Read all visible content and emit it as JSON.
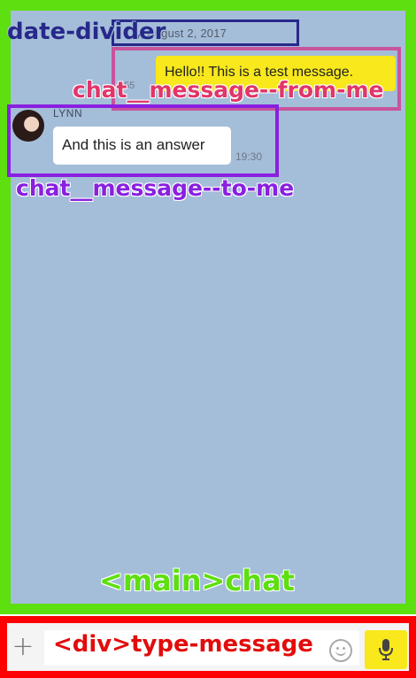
{
  "chat": {
    "date_divider": "…y, August 2, 2017",
    "messages": [
      {
        "direction": "from-me",
        "text": "Hello!! This is a test message.",
        "time": "55"
      },
      {
        "direction": "to-me",
        "sender": "LYNN",
        "text": "And this is an answer",
        "time": "19:30"
      }
    ]
  },
  "annotations": {
    "date_divider": "date-divider",
    "from_me": "chat__message--from-me",
    "to_me": "chat__message--to-me",
    "main": "<main>chat",
    "type_message": "<div>type-message"
  },
  "type_message": {
    "plus_label": "+",
    "value": "",
    "placeholder": ""
  },
  "icons": {
    "plus": "plus-icon",
    "emoji": "smiley-icon",
    "mic": "microphone-icon"
  },
  "colors": {
    "chat_background": "#a4bdd9",
    "my_bubble": "#f8e81c",
    "their_bubble": "#ffffff",
    "main_frame": "#5ddf10",
    "type_frame": "#ff0000",
    "date_frame": "#27288a",
    "from_me_frame": "#c8549c",
    "to_me_frame": "#8a1fe0"
  }
}
